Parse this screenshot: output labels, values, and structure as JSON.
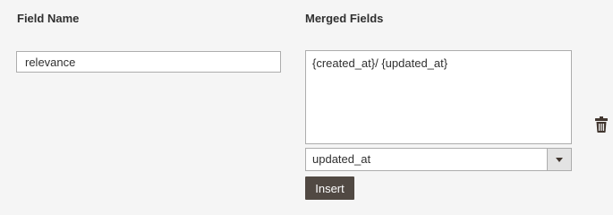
{
  "columns": {
    "field_name_label": "Field Name",
    "merged_fields_label": "Merged Fields"
  },
  "field_name": {
    "value": "relevance"
  },
  "merged_fields": {
    "value": "{created_at}/ {updated_at}"
  },
  "field_select": {
    "selected": "updated_at"
  },
  "actions": {
    "insert_label": "Insert",
    "delete_icon": "trash-icon"
  },
  "colors": {
    "background": "#f5f5f5",
    "button_bg": "#514943",
    "border": "#adadad",
    "select_arrow_bg": "#e3e3e3"
  }
}
